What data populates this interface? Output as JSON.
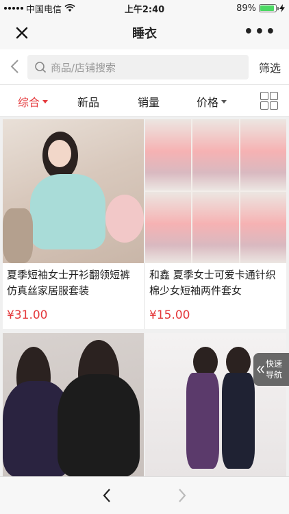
{
  "status_bar": {
    "carrier": "中国电信",
    "time": "上午2:40",
    "battery": "89%",
    "battery_level": 0.89
  },
  "nav": {
    "title": "睡衣"
  },
  "search": {
    "placeholder": "商品/店铺搜索",
    "filter_label": "筛选"
  },
  "sort_tabs": [
    {
      "label": "综合",
      "active": true
    },
    {
      "label": "新品"
    },
    {
      "label": "销量"
    },
    {
      "label": "价格"
    }
  ],
  "products": [
    {
      "name": "夏季短袖女士开衫翻领短裤仿真丝家居服套装",
      "price": "¥31.00"
    },
    {
      "name": "和鑫 夏季女士可爱卡通针织棉少女短袖两件套女",
      "price": "¥15.00"
    },
    {
      "name": "",
      "price": ""
    },
    {
      "name": "",
      "price": ""
    }
  ],
  "quick_nav": {
    "line1": "快速",
    "line2": "导航"
  },
  "colors": {
    "accent": "#e4393c"
  }
}
